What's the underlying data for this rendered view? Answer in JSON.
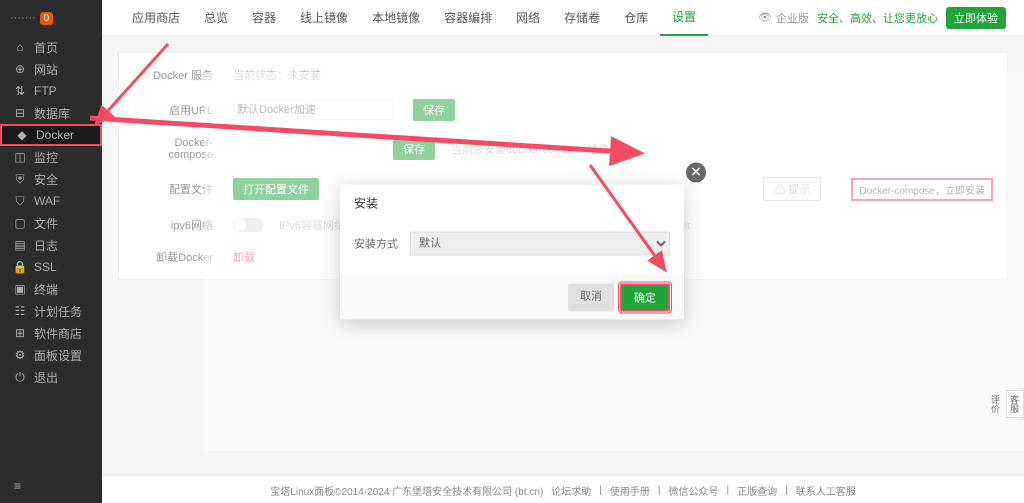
{
  "sidebar": {
    "logo": "·······",
    "badge": "0",
    "items": [
      {
        "icon": "home",
        "label": "首页"
      },
      {
        "icon": "globe",
        "label": "网站"
      },
      {
        "icon": "ftp",
        "label": "FTP"
      },
      {
        "icon": "db",
        "label": "数据库"
      },
      {
        "icon": "docker",
        "label": "Docker",
        "active": true
      },
      {
        "icon": "monitor",
        "label": "监控"
      },
      {
        "icon": "shield",
        "label": "安全"
      },
      {
        "icon": "waf",
        "label": "WAF"
      },
      {
        "icon": "file",
        "label": "文件"
      },
      {
        "icon": "log",
        "label": "日志"
      },
      {
        "icon": "ssl",
        "label": "SSL"
      },
      {
        "icon": "terminal",
        "label": "终端"
      },
      {
        "icon": "task",
        "label": "计划任务"
      },
      {
        "icon": "store",
        "label": "软件商店"
      },
      {
        "icon": "settings",
        "label": "面板设置"
      },
      {
        "icon": "exit",
        "label": "退出"
      }
    ]
  },
  "tabs": {
    "items": [
      "应用商店",
      "总览",
      "容器",
      "线上镜像",
      "本地镜像",
      "容器编排",
      "网络",
      "存储卷",
      "仓库",
      "设置"
    ],
    "active": "设置",
    "eye": "企业版",
    "safe": "安全、高效、让您更放心",
    "btn": "立即体验"
  },
  "panel": {
    "status_label": "Docker 服务",
    "status_val": "当前状态：未安装",
    "mirror_label": "启用URL",
    "mirror_placeholder": "默认Docker加速",
    "mirror_btn": "保存",
    "compose_label": "Docker-compose",
    "compose_btn": "保存",
    "compose_note": "当前未安装docker-compose插件",
    "file_label": "配置文件",
    "file_btn": "打开配置文件",
    "notice_btn": "提示",
    "notice_text": "Docker-compose，立即安装",
    "ipv6_label": "ipv6网络",
    "ipv6_note": "IPv6容器网络开关需要docker版本大于20.10.17docker二进制文件位置/usr/bin/docker",
    "uninstall_label": "卸载Docker",
    "uninstall_btn": "卸载"
  },
  "modal": {
    "title": "安装",
    "method_label": "安装方式",
    "method_value": "默认",
    "cancel": "取消",
    "ok": "确定"
  },
  "footer": {
    "copyright": "宝塔Linux面板©2014-2024 广东堡塔安全技术有限公司 (bt.cn)",
    "links": [
      "论坛求助",
      "使用手册",
      "微信公众号",
      "正版查询",
      "联系人工客服"
    ]
  },
  "side_widget": [
    "客服",
    "评价"
  ]
}
